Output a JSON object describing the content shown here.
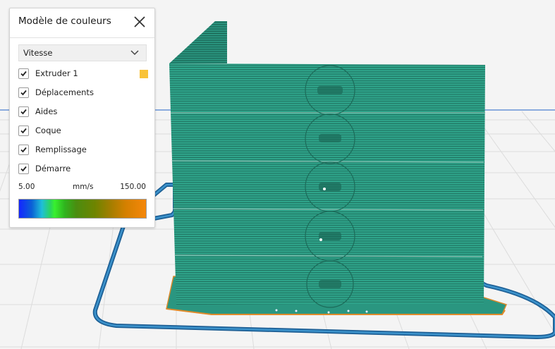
{
  "panel": {
    "title": "Modèle de couleurs",
    "close_icon": "close-icon",
    "dropdown": {
      "selected": "Vitesse",
      "icon": "chevron-down-icon"
    },
    "items": [
      {
        "label": "Extruder 1",
        "checked": true,
        "swatch_color": "#f9c339"
      },
      {
        "label": "Déplacements",
        "checked": true
      },
      {
        "label": "Aides",
        "checked": true
      },
      {
        "label": "Coque",
        "checked": true
      },
      {
        "label": "Remplissage",
        "checked": true
      },
      {
        "label": "Démarre",
        "checked": true
      }
    ],
    "range": {
      "min": "5.00",
      "unit": "mm/s",
      "max": "150.00"
    },
    "gradient_colors": [
      "#1426ff",
      "#2bd65a",
      "#38f02e",
      "#6f8400",
      "#f5870a"
    ]
  },
  "viewport": {
    "model_color": "#2ea58b",
    "travel_color": "#2a7fb6",
    "background": "#f4f4f4"
  }
}
